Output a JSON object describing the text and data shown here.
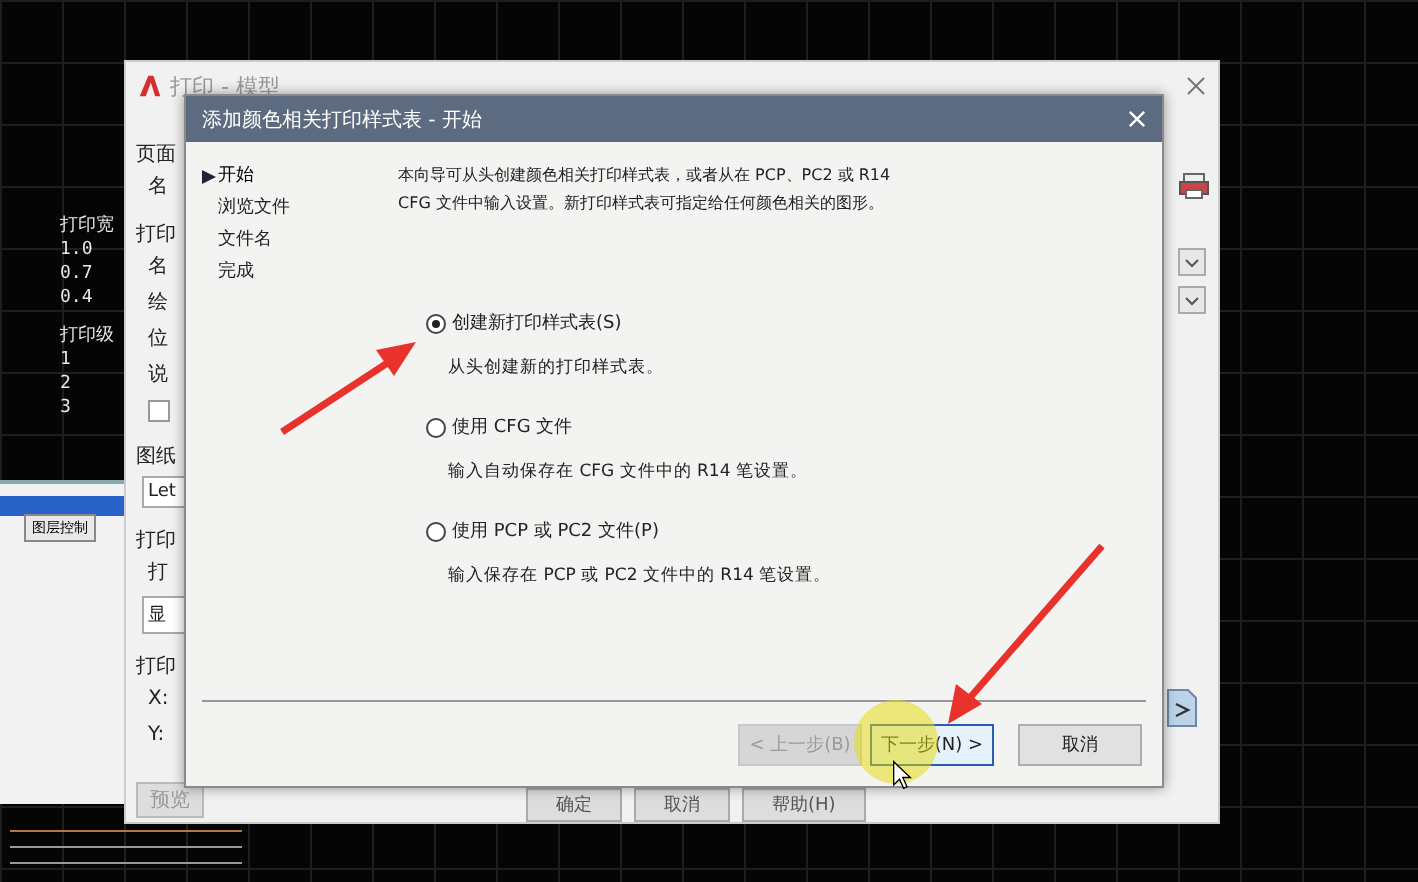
{
  "cad_canvas": {
    "labels": [
      "打印宽",
      "1.0",
      "0.7",
      "0.4",
      "打印级",
      "1",
      "2",
      "3"
    ]
  },
  "layer_window": {
    "button": "图层控制"
  },
  "print_dialog": {
    "title": "打印 - 模型",
    "labels": [
      {
        "kind": "heading",
        "text": "页面"
      },
      {
        "kind": "label",
        "text": "名"
      },
      {
        "kind": "heading",
        "text": "打印"
      },
      {
        "kind": "label",
        "text": "名"
      },
      {
        "kind": "label",
        "text": "绘"
      },
      {
        "kind": "label",
        "text": "位"
      },
      {
        "kind": "label",
        "text": "说"
      },
      {
        "kind": "checkbox",
        "checked": false
      },
      {
        "kind": "heading",
        "text": "图纸"
      },
      {
        "kind": "combo",
        "text": "Let"
      },
      {
        "kind": "heading",
        "text": "打印"
      },
      {
        "kind": "label",
        "text": "打"
      },
      {
        "kind": "combo",
        "text": "显"
      },
      {
        "kind": "heading",
        "text": "打印"
      },
      {
        "kind": "label",
        "text": "X:"
      },
      {
        "kind": "label",
        "text": "Y:"
      }
    ],
    "preview_button": "预览",
    "buttons": [
      "确定",
      "取消",
      "帮助(H)"
    ]
  },
  "wizard": {
    "title": "添加颜色相关打印样式表 - 开始",
    "steps": [
      {
        "label": "开始",
        "selected": true
      },
      {
        "label": "浏览文件",
        "selected": false
      },
      {
        "label": "文件名",
        "selected": false
      },
      {
        "label": "完成",
        "selected": false
      }
    ],
    "description": "本向导可从头创建颜色相关打印样式表，或者从在 PCP、PC2 或 R14 CFG 文件中输入设置。新打印样式表可指定给任何颜色相关的图形。",
    "options": [
      {
        "label": "创建新打印样式表(S)",
        "hint": "从头创建新的打印样式表。",
        "selected": true
      },
      {
        "label": "使用 CFG 文件",
        "hint": "输入自动保存在 CFG 文件中的 R14 笔设置。",
        "selected": false
      },
      {
        "label": "使用 PCP 或 PC2 文件(P)",
        "hint": "输入保存在 PCP 或 PC2 文件中的 R14 笔设置。",
        "selected": false
      }
    ],
    "buttons": [
      {
        "label": "< 上一步(B)",
        "disabled": true,
        "default": false
      },
      {
        "label": "下一步(N) >",
        "disabled": false,
        "default": true
      },
      {
        "label": "取消",
        "disabled": false,
        "default": false
      }
    ]
  }
}
